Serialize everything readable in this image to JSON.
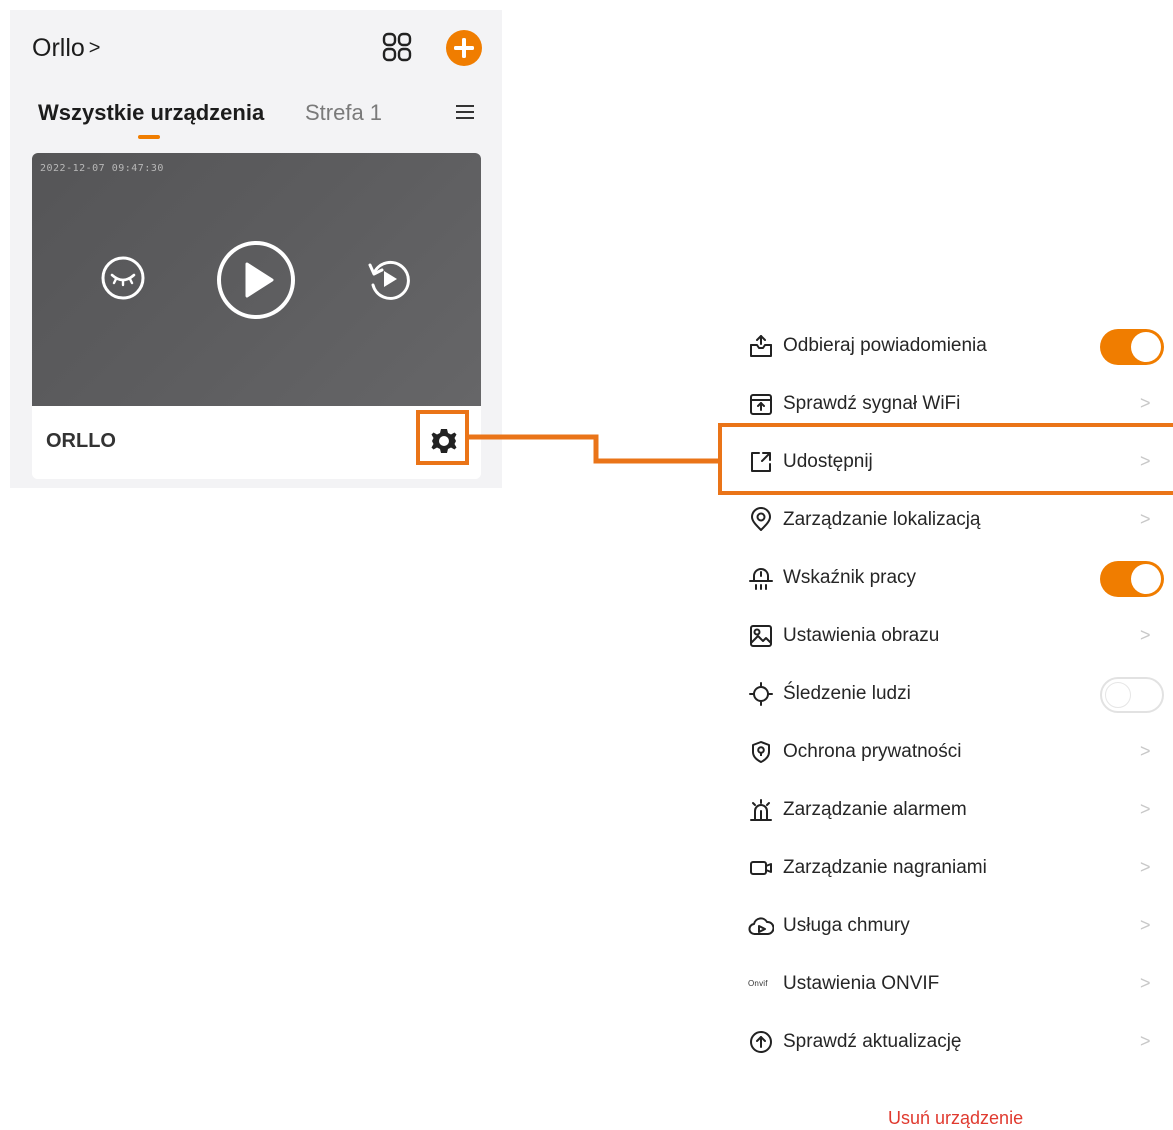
{
  "header": {
    "title": "Orllo",
    "title_chevron": ">",
    "grid_icon": "grid-icon",
    "add_icon": "plus-circle-icon",
    "accent": "#f07d00"
  },
  "tabs": [
    {
      "label": "Wszystkie urządzenia",
      "active": true
    },
    {
      "label": "Strefa 1",
      "active": false
    }
  ],
  "device": {
    "timestamp": "2022-12-07 09:47:30",
    "name": "ORLLO",
    "controls": [
      "privacy-eye-icon",
      "play-icon",
      "replay-icon"
    ],
    "settings_icon": "gear-icon"
  },
  "settings": {
    "items": [
      {
        "label": "Odbieraj powiadomienia",
        "icon": "notification-tray-icon",
        "control": "toggle",
        "on": true
      },
      {
        "label": "Sprawdź sygnał WiFi",
        "icon": "wifi-check-icon",
        "control": "arrow",
        "arrow": ">"
      },
      {
        "label": "Udostępnij",
        "icon": "share-icon",
        "control": "arrow",
        "arrow": ">",
        "highlighted": true
      },
      {
        "label": "Zarządzanie lokalizacją",
        "icon": "location-pin-icon",
        "control": "arrow",
        "arrow": ">"
      },
      {
        "label": "Wskaźnik pracy",
        "icon": "indicator-light-icon",
        "control": "toggle",
        "on": true
      },
      {
        "label": "Ustawienia obrazu",
        "icon": "image-icon",
        "control": "arrow",
        "arrow": ">"
      },
      {
        "label": "Śledzenie ludzi",
        "icon": "crosshair-icon",
        "control": "toggle",
        "on": false
      },
      {
        "label": "Ochrona prywatności",
        "icon": "privacy-shield-icon",
        "control": "arrow",
        "arrow": ">"
      },
      {
        "label": "Zarządzanie alarmem",
        "icon": "alarm-siren-icon",
        "control": "arrow",
        "arrow": ">"
      },
      {
        "label": "Zarządzanie nagraniami",
        "icon": "video-camera-icon",
        "control": "arrow",
        "arrow": ">"
      },
      {
        "label": "Usługa chmury",
        "icon": "cloud-icon",
        "control": "arrow",
        "arrow": ">"
      },
      {
        "label": "Ustawienia ONVIF",
        "icon": "onvif-icon",
        "icon_text": "Onvif",
        "control": "arrow",
        "arrow": ">"
      },
      {
        "label": "Sprawdź aktualizację",
        "icon": "update-arrow-icon",
        "control": "arrow",
        "arrow": ">"
      }
    ],
    "remove_label": "Usuń urządzenie",
    "remove_color": "#e03a2f",
    "callout_color": "#ea7418"
  }
}
